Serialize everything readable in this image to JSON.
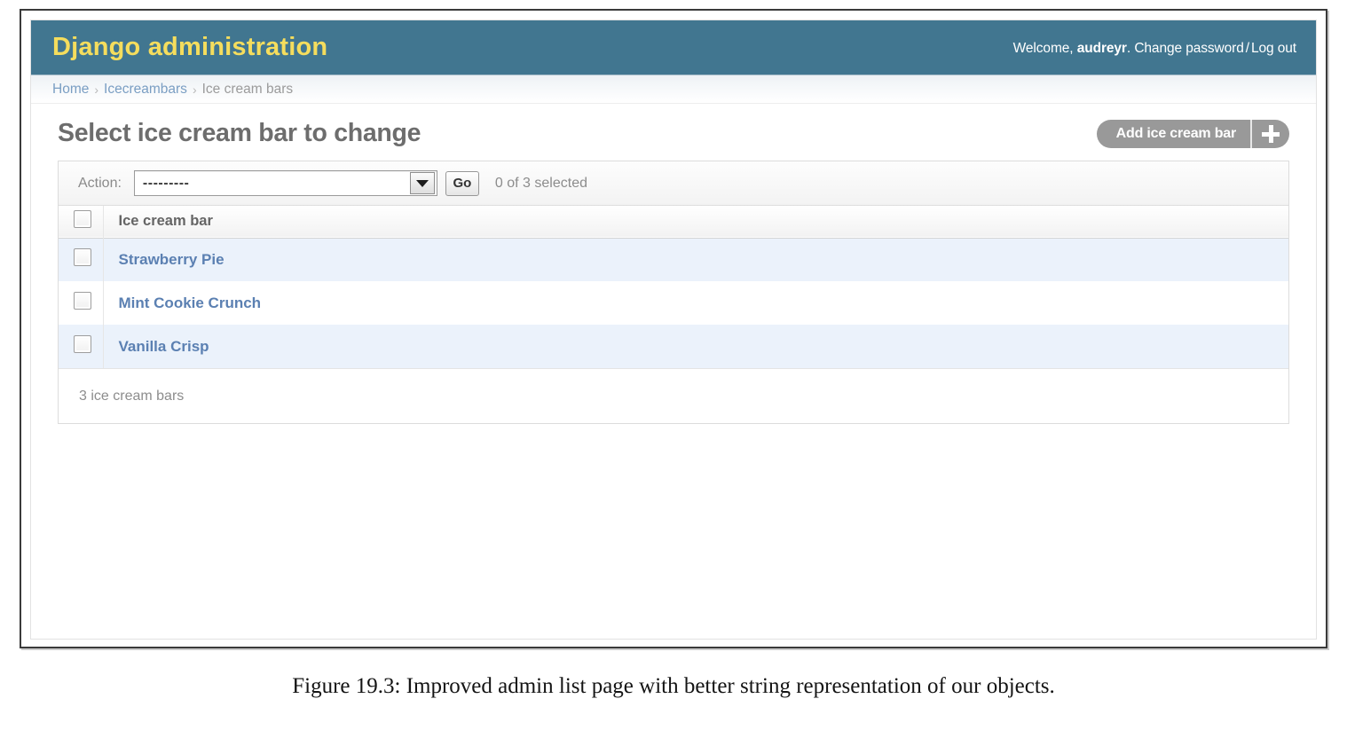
{
  "header": {
    "branding": "Django administration",
    "welcome_prefix": "Welcome,",
    "username": "audreyr",
    "username_suffix": ".",
    "change_password": "Change password",
    "separator": "/",
    "logout": "Log out",
    "bg_color": "#417690",
    "brand_color": "#f5dd5d"
  },
  "breadcrumbs": {
    "home": "Home",
    "sep1": "›",
    "app": "Icecreambars",
    "sep2": "›",
    "current": "Ice cream bars"
  },
  "content": {
    "page_title": "Select ice cream bar to change",
    "add_button_label": "Add ice cream bar",
    "add_button_icon": "plus-icon"
  },
  "actions": {
    "label": "Action:",
    "selected_option": "---------",
    "options": [
      "---------"
    ],
    "dropdown_icon": "chevron-down-icon",
    "go_label": "Go",
    "selection_counter": "0 of 3 selected"
  },
  "table": {
    "columns": [
      "Ice cream bar"
    ],
    "select_all_checkbox": "checkbox-unchecked",
    "rows": [
      {
        "checkbox": "checkbox-unchecked",
        "name": "Strawberry Pie"
      },
      {
        "checkbox": "checkbox-unchecked",
        "name": "Mint Cookie Crunch"
      },
      {
        "checkbox": "checkbox-unchecked",
        "name": "Vanilla Crisp"
      }
    ]
  },
  "footer": {
    "count_text": "3 ice cream bars"
  },
  "caption": {
    "text": "Figure 19.3: Improved admin list page with better string representation of our objects."
  }
}
